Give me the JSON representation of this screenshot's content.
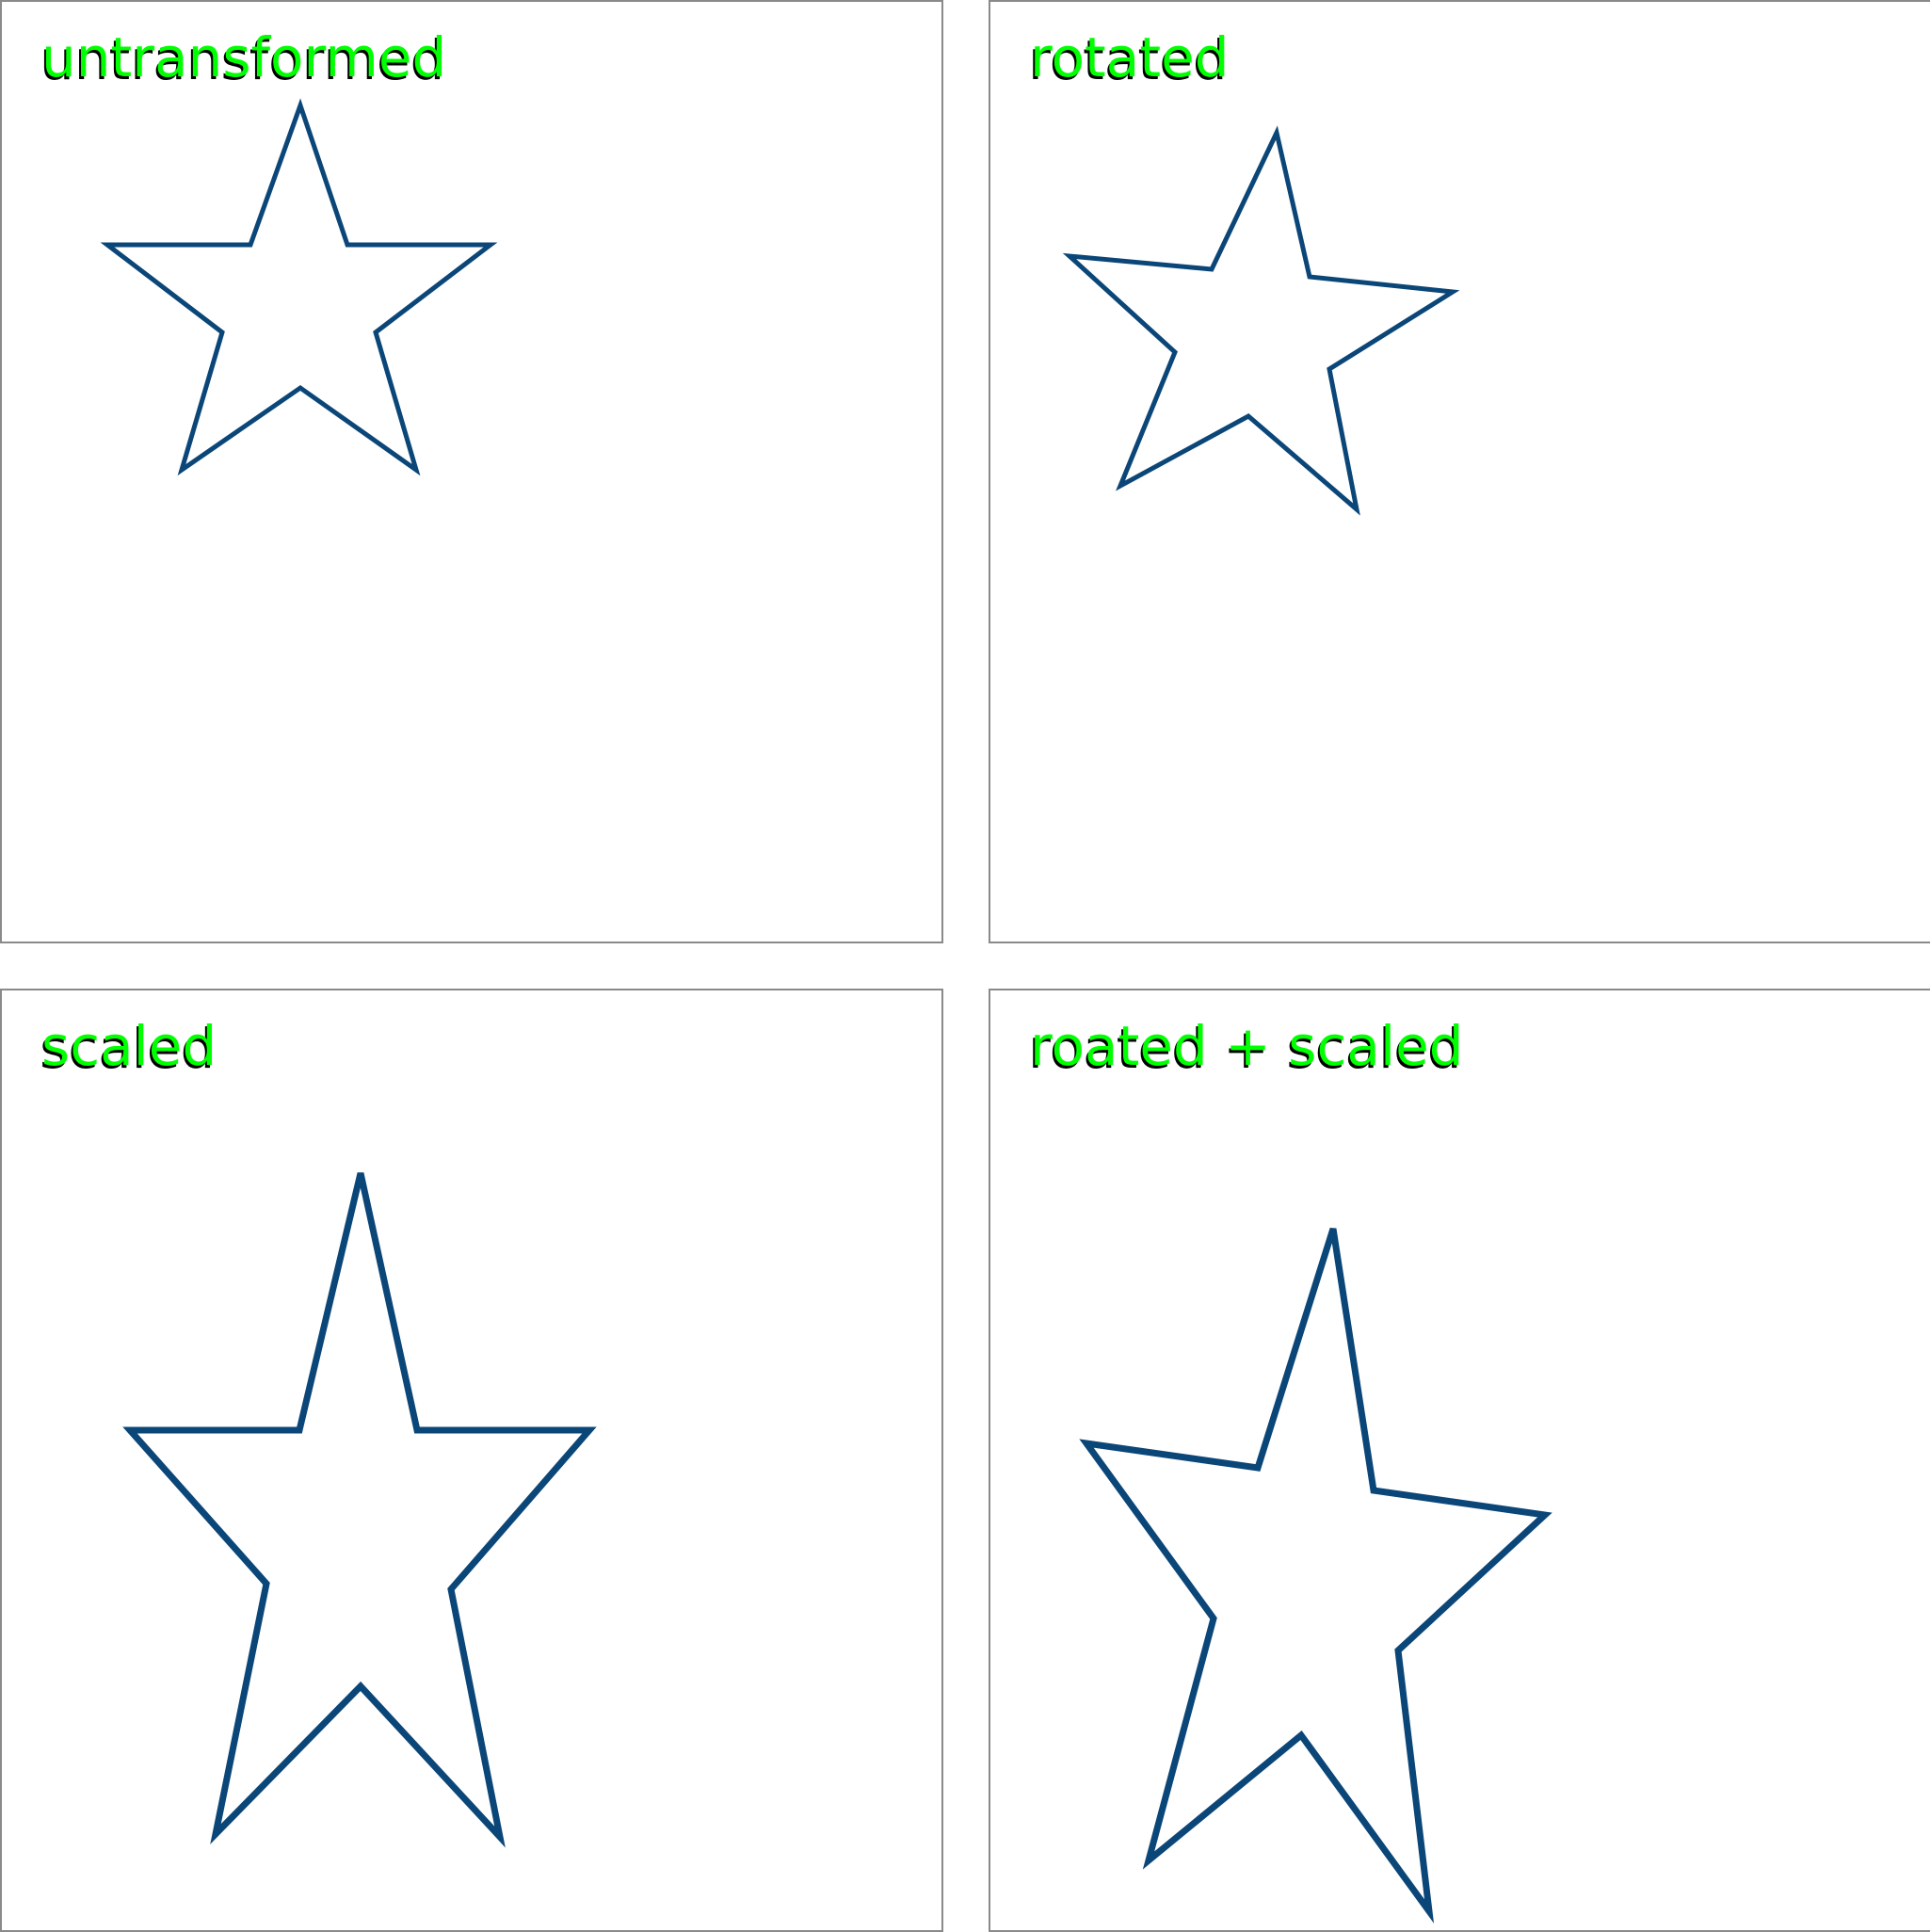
{
  "colors": {
    "label_text": "#00ff00",
    "label_shadow": "#000000",
    "star_stroke": "#0b4678",
    "panel_border": "#8a8a8a",
    "background": "#ffffff"
  },
  "panels": [
    {
      "label": "untransformed",
      "shape": "star-icon"
    },
    {
      "label": "rotated",
      "shape": "star-icon"
    },
    {
      "label": "scaled",
      "shape": "star-icon"
    },
    {
      "label": "roated + scaled",
      "shape": "star-icon"
    }
  ]
}
